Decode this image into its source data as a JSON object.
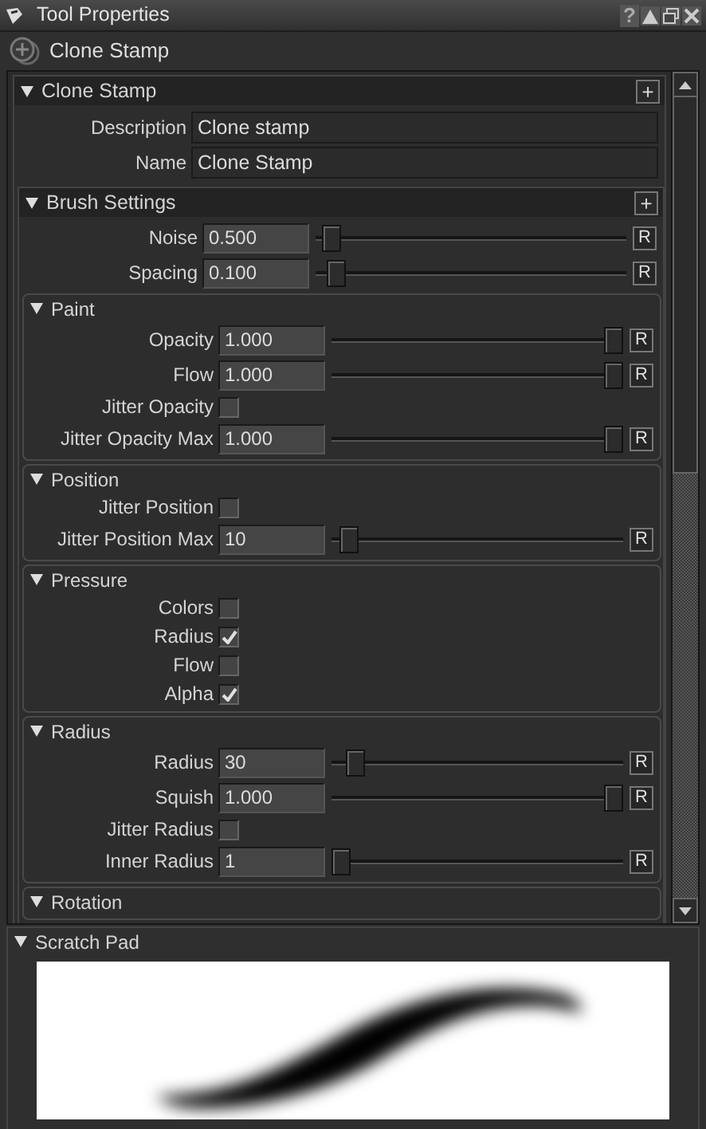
{
  "window": {
    "title": "Tool Properties",
    "help": "?"
  },
  "tool": {
    "name": "Clone Stamp"
  },
  "panel": {
    "title": "Clone Stamp",
    "expanded": true,
    "add": "+",
    "fields": [
      {
        "label": "Description",
        "value": "Clone stamp"
      },
      {
        "label": "Name",
        "value": "Clone Stamp"
      }
    ],
    "sections": [
      {
        "title": "Brush Settings",
        "expanded": true,
        "add": "+",
        "rows": [
          {
            "kind": "slider",
            "label": "Noise",
            "value": "0.500",
            "level": 0.02,
            "reset": "R"
          },
          {
            "kind": "slider",
            "label": "Spacing",
            "value": "0.100",
            "level": 0.04,
            "reset": "R"
          }
        ],
        "groups": [
          {
            "title": "Paint",
            "expanded": true,
            "rows": [
              {
                "kind": "slider",
                "label": "Opacity",
                "value": "1.000",
                "level": 1,
                "reset": "R"
              },
              {
                "kind": "slider",
                "label": "Flow",
                "value": "1.000",
                "level": 1,
                "reset": "R"
              },
              {
                "kind": "checkbox",
                "label": "Jitter Opacity",
                "checked": false
              },
              {
                "kind": "slider",
                "label": "Jitter Opacity Max",
                "value": "1.000",
                "level": 1,
                "reset": "R"
              }
            ]
          },
          {
            "title": "Position",
            "expanded": true,
            "rows": [
              {
                "kind": "checkbox",
                "label": "Jitter Position",
                "checked": false
              },
              {
                "kind": "slider",
                "label": "Jitter Position Max",
                "value": "10",
                "level": 0.03,
                "reset": "R"
              }
            ]
          },
          {
            "title": "Pressure",
            "expanded": true,
            "rows": [
              {
                "kind": "check",
                "label": "Colors",
                "checked": false
              },
              {
                "kind": "check",
                "label": "Radius",
                "checked": true
              },
              {
                "kind": "check",
                "label": "Flow",
                "checked": false
              },
              {
                "kind": "check",
                "label": "Alpha",
                "checked": true
              }
            ]
          },
          {
            "title": "Radius",
            "expanded": true,
            "rows": [
              {
                "kind": "slider",
                "label": "Radius",
                "value": "30",
                "level": 0.05,
                "reset": "R"
              },
              {
                "kind": "slider",
                "label": "Squish",
                "value": "1.000",
                "level": 1,
                "reset": "R"
              },
              {
                "kind": "checkbox",
                "label": "Jitter Radius",
                "checked": false
              },
              {
                "kind": "slider",
                "label": "Inner Radius",
                "value": "1",
                "level": 0,
                "reset": "R"
              }
            ]
          },
          {
            "title": "Rotation",
            "expanded": true
          }
        ]
      }
    ]
  },
  "scratch_pad": {
    "title": "Scratch Pad",
    "expanded": true
  }
}
